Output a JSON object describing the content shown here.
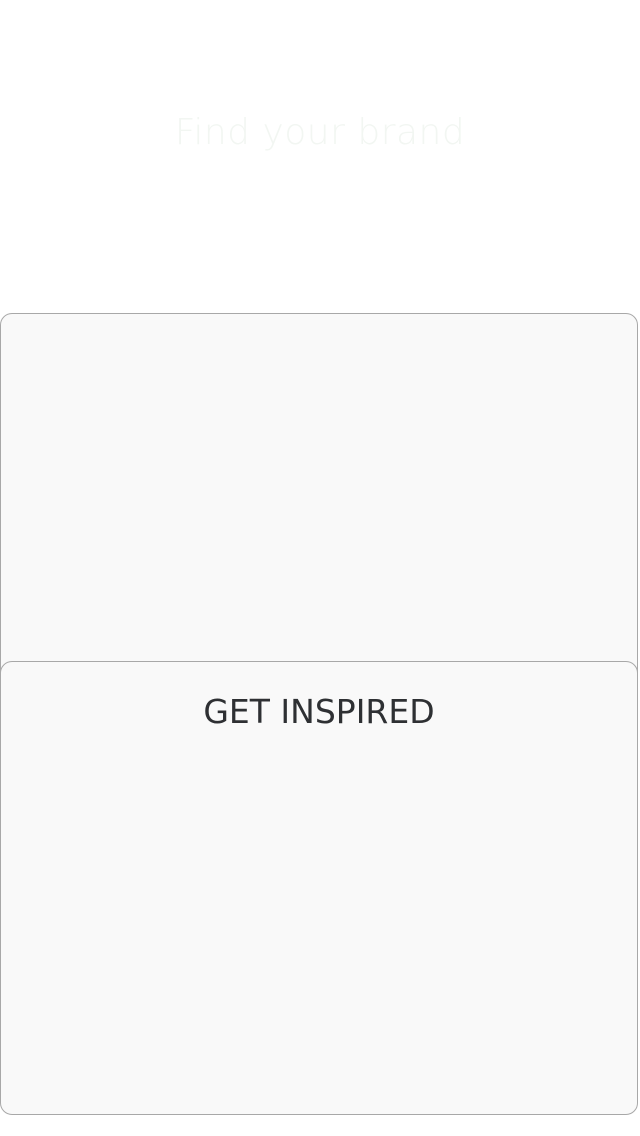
{
  "header": {
    "title": "Find your brand"
  },
  "cards": [
    {
      "title": ""
    },
    {
      "title": "GET INSPIRED"
    }
  ]
}
